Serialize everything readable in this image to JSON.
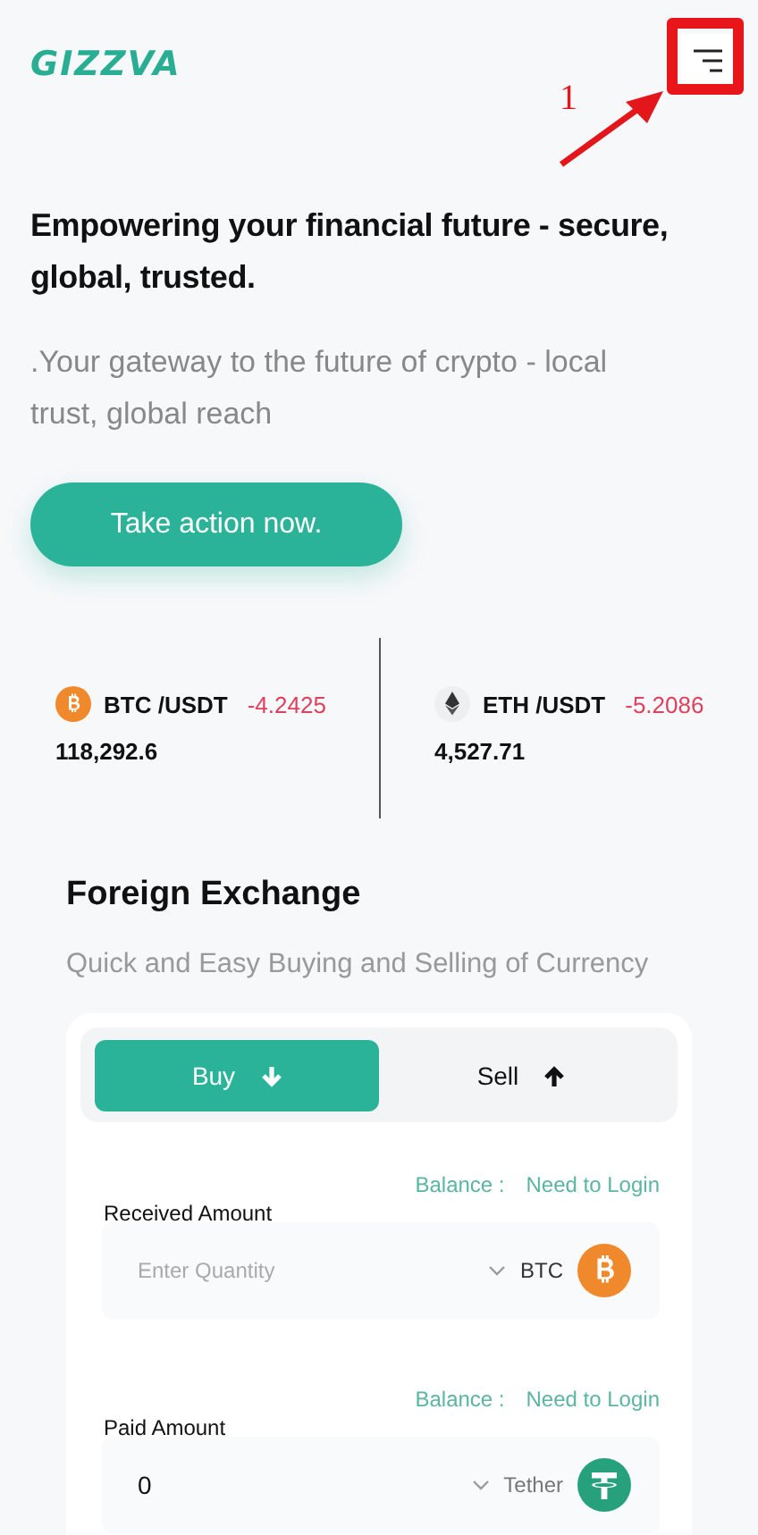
{
  "header": {
    "logo": "GIZZVA",
    "annotation": {
      "number": "1"
    }
  },
  "hero": {
    "title": "Empowering your financial future - secure, global, trusted.",
    "subtitle": ".Your gateway to the future of crypto - local trust, global reach",
    "button": "Take action now."
  },
  "tickers": [
    {
      "kind": "btc",
      "pair": "BTC /USDT",
      "change": "-4.2425",
      "price": "118,292.6"
    },
    {
      "kind": "eth",
      "pair": "ETH /USDT",
      "change": "-5.2086",
      "price": "4,527.71"
    }
  ],
  "exchange": {
    "title": "Foreign Exchange",
    "subtitle": "Quick and Easy Buying and Selling of Currency",
    "tabs": [
      {
        "label": "Buy",
        "selected": true,
        "kind": "down"
      },
      {
        "label": "Sell",
        "selected": false,
        "kind": "up"
      }
    ],
    "fields": [
      {
        "balance_label": "Balance :",
        "balance_value": "Need to Login",
        "label": "Received Amount",
        "placeholder": "Enter Quantity",
        "currency": "BTC",
        "kind": "btc"
      },
      {
        "balance_label": "Balance :",
        "balance_value": "Need to Login",
        "label": "Paid Amount",
        "value": "0",
        "currency": "Tether",
        "kind": "tether"
      }
    ]
  }
}
